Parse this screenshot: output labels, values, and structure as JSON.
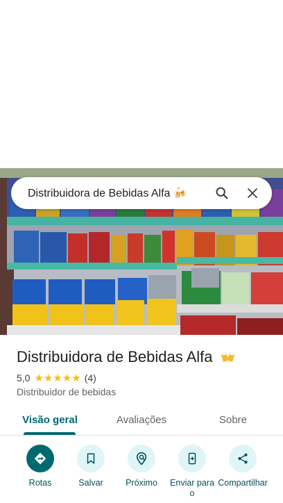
{
  "search": {
    "query": "Distribuidora de Bebidas Alfa 🍻"
  },
  "place": {
    "name": "Distribuidora de Bebidas Alfa",
    "rating": "5,0",
    "stars": "★★★★★",
    "review_count": "(4)",
    "category": "Distribuidor de bebidas"
  },
  "tabs": [
    {
      "label": "Visão geral"
    },
    {
      "label": "Avaliações"
    },
    {
      "label": "Sobre"
    }
  ],
  "actions": [
    {
      "label": "Rotas",
      "icon": "directions-icon"
    },
    {
      "label": "Salvar",
      "icon": "bookmark-icon"
    },
    {
      "label": "Próximo",
      "icon": "nearby-icon"
    },
    {
      "label": "Enviar para o",
      "icon": "send-to-phone-icon"
    },
    {
      "label": "Compartilhar",
      "icon": "share-icon"
    }
  ],
  "colors": {
    "accent": "#00696f",
    "action_bg": "#dff5f7",
    "star": "#fbbc04"
  }
}
